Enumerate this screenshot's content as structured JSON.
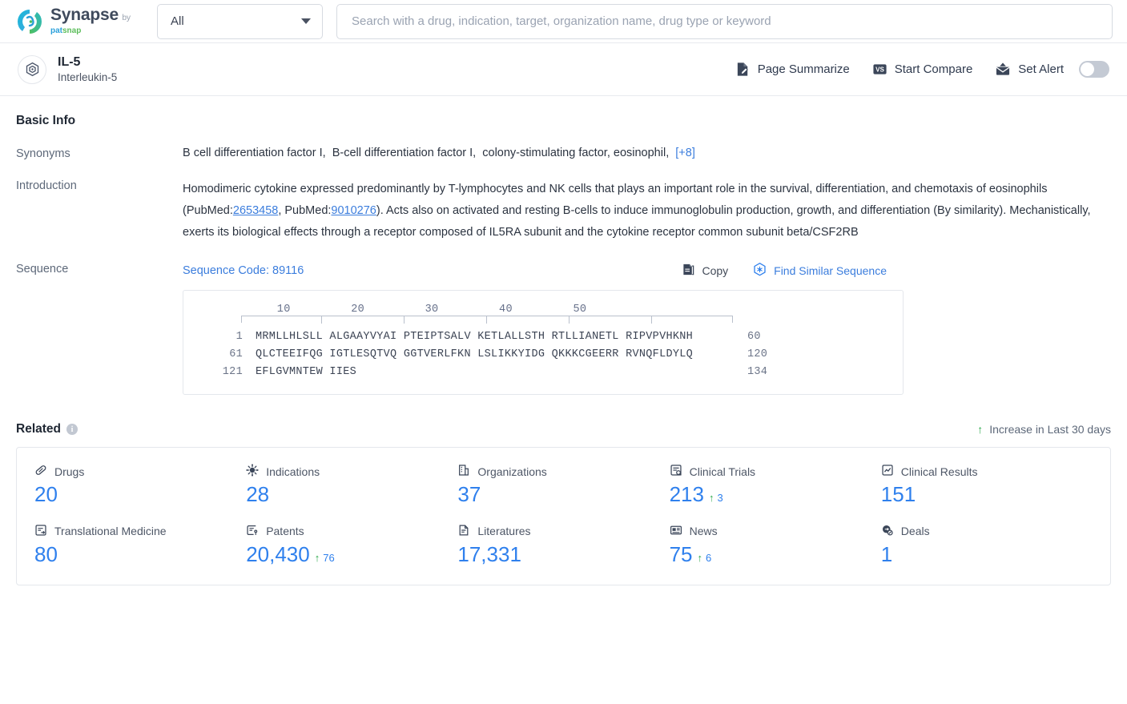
{
  "brand": {
    "name": "Synapse",
    "by": "by",
    "pat": "pat",
    "snap": "snap",
    "logo_icon": "synapse-swirl-logo"
  },
  "search": {
    "scope_value": "All",
    "scope_icon": "chevron-down-icon",
    "placeholder": "Search with a drug, indication, target, organization name, drug type or keyword",
    "value": ""
  },
  "entity": {
    "icon": "target-node-icon",
    "title": "IL-5",
    "subtitle": "Interleukin-5",
    "actions": [
      {
        "label": "Page Summarize",
        "icon": "summarize-page-icon"
      },
      {
        "label": "Start Compare",
        "icon": "vs-compare-icon"
      },
      {
        "label": "Set Alert",
        "icon": "alert-mail-icon"
      }
    ],
    "alert_toggle_state": "off"
  },
  "basic_info": {
    "heading": "Basic Info",
    "synonyms": {
      "label": "Synonyms",
      "items": [
        "B cell differentiation factor I",
        "B-cell differentiation factor I",
        "colony-stimulating factor",
        "eosinophil"
      ],
      "more_label": "[+8]"
    },
    "introduction": {
      "label": "Introduction",
      "text_part_1": "Homodimeric cytokine expressed predominantly by T-lymphocytes and NK cells that plays an important role in the survival, differentiation, and chemotaxis of eosinophils (PubMed:",
      "link_1": "2653458",
      "text_part_2": ", PubMed:",
      "link_2": "9010276",
      "text_part_3": "). Acts also on activated and resting B-cells to induce immunoglobulin production, growth, and differentiation (By similarity). Mechanistically, exerts its biological effects through a receptor composed of IL5RA subunit and the cytokine receptor common subunit beta/CSF2RB"
    },
    "sequence": {
      "label": "Sequence",
      "code_label": "Sequence Code: 89116",
      "copy_label": "Copy",
      "copy_icon": "copy-icon",
      "find_label": "Find Similar Sequence",
      "find_icon": "find-similar-sequence-icon",
      "ruler_ticks": [
        "10",
        "20",
        "30",
        "40",
        "50"
      ],
      "lines": [
        {
          "start": "1",
          "residues": "MRMLLHLSLL ALGAAYVYAI PTEIPTSALV KETLALLSTH RTLLIANETL RIPVPVHKNH",
          "end": "60"
        },
        {
          "start": "61",
          "residues": "QLCTEEIFQG IGTLESQTVQ GGTVERLFKN LSLIKKYIDG QKKKCGEERR RVNQFLDYLQ",
          "end": "120"
        },
        {
          "start": "121",
          "residues": "EFLGVMNTEW IIES",
          "end": "134"
        }
      ]
    }
  },
  "related": {
    "heading": "Related",
    "info_icon": "info-icon",
    "increase_note": "Increase in Last 30 days",
    "increase_arrow": "↑",
    "stats": [
      {
        "label": "Drugs",
        "icon": "capsule-icon",
        "value": "20",
        "delta": null
      },
      {
        "label": "Indications",
        "icon": "virus-icon",
        "value": "28",
        "delta": null
      },
      {
        "label": "Organizations",
        "icon": "building-icon",
        "value": "37",
        "delta": null
      },
      {
        "label": "Clinical Trials",
        "icon": "clinical-trial-icon",
        "value": "213",
        "delta": "3"
      },
      {
        "label": "Clinical Results",
        "icon": "clinical-results-icon",
        "value": "151",
        "delta": null
      },
      {
        "label": "Translational Medicine",
        "icon": "translational-icon",
        "value": "80",
        "delta": null
      },
      {
        "label": "Patents",
        "icon": "patent-icon",
        "value": "20,430",
        "delta": "76"
      },
      {
        "label": "Literatures",
        "icon": "literature-icon",
        "value": "17,331",
        "delta": null
      },
      {
        "label": "News",
        "icon": "news-icon",
        "value": "75",
        "delta": "6"
      },
      {
        "label": "Deals",
        "icon": "deals-icon",
        "value": "1",
        "delta": null
      }
    ]
  },
  "colors": {
    "accent_blue": "#2f80ed",
    "link_blue": "#3b7ddd",
    "increase_green": "#2faa4d",
    "header_navy": "#2f3a4e"
  }
}
